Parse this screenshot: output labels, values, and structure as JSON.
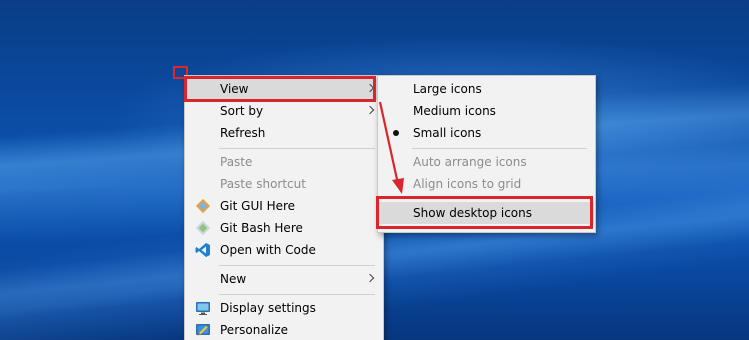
{
  "main_menu": {
    "items": [
      {
        "label": "View",
        "type": "submenu"
      },
      {
        "label": "Sort by",
        "type": "submenu"
      },
      {
        "label": "Refresh",
        "type": "item"
      },
      {
        "label": "Paste",
        "type": "disabled"
      },
      {
        "label": "Paste shortcut",
        "type": "disabled"
      },
      {
        "label": "Git GUI Here",
        "type": "item",
        "icon": "git-gui-icon"
      },
      {
        "label": "Git Bash Here",
        "type": "item",
        "icon": "git-bash-icon"
      },
      {
        "label": "Open with Code",
        "type": "item",
        "icon": "vscode-icon"
      },
      {
        "label": "New",
        "type": "submenu"
      },
      {
        "label": "Display settings",
        "type": "item",
        "icon": "display-icon"
      },
      {
        "label": "Personalize",
        "type": "item",
        "icon": "personalize-icon"
      }
    ]
  },
  "view_submenu": {
    "items": [
      {
        "label": "Large icons",
        "checked": false
      },
      {
        "label": "Medium icons",
        "checked": false
      },
      {
        "label": "Small icons",
        "checked": true
      },
      {
        "label": "Auto arrange icons",
        "disabled": true
      },
      {
        "label": "Align icons to grid",
        "disabled": true
      },
      {
        "label": "Show desktop icons",
        "highlighted": true
      }
    ]
  },
  "annotation_color": "#d9252b"
}
